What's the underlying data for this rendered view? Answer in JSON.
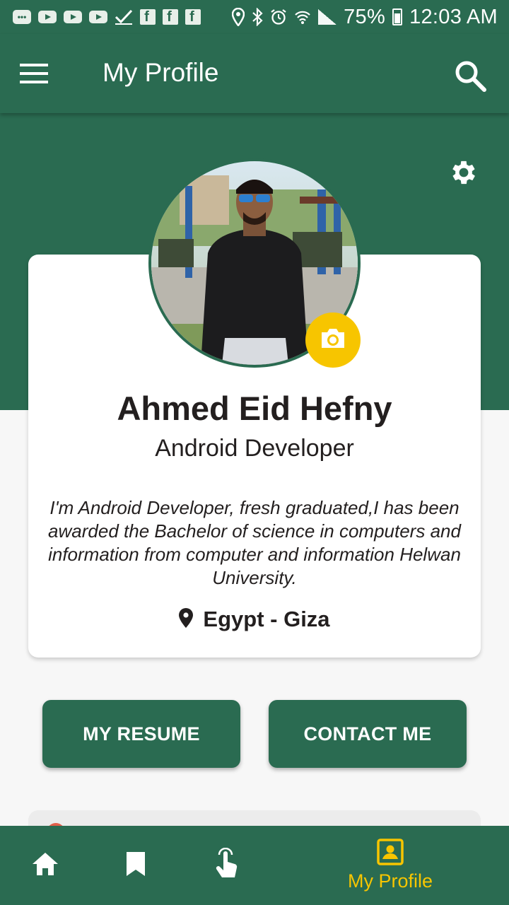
{
  "status_bar": {
    "battery": "75%",
    "time": "12:03 AM"
  },
  "app_bar": {
    "title": "My Profile"
  },
  "profile": {
    "name": "Ahmed Eid Hefny",
    "role": "Android Developer",
    "bio": "I'm Android Developer, fresh graduated,I has been awarded the Bachelor of science in computers and information from computer and information Helwan University.",
    "location": "Egypt - Giza"
  },
  "actions": {
    "resume_label": "MY RESUME",
    "contact_label": "CONTACT ME"
  },
  "bottom_nav": {
    "items": [
      {
        "icon": "home-icon"
      },
      {
        "icon": "bookmark-icon"
      },
      {
        "icon": "touch-icon"
      },
      {
        "icon": "profile-icon",
        "label": "My Profile",
        "active": true
      }
    ]
  },
  "colors": {
    "primary": "#2a6b51",
    "accent": "#f7c500",
    "text": "#231f1f"
  }
}
